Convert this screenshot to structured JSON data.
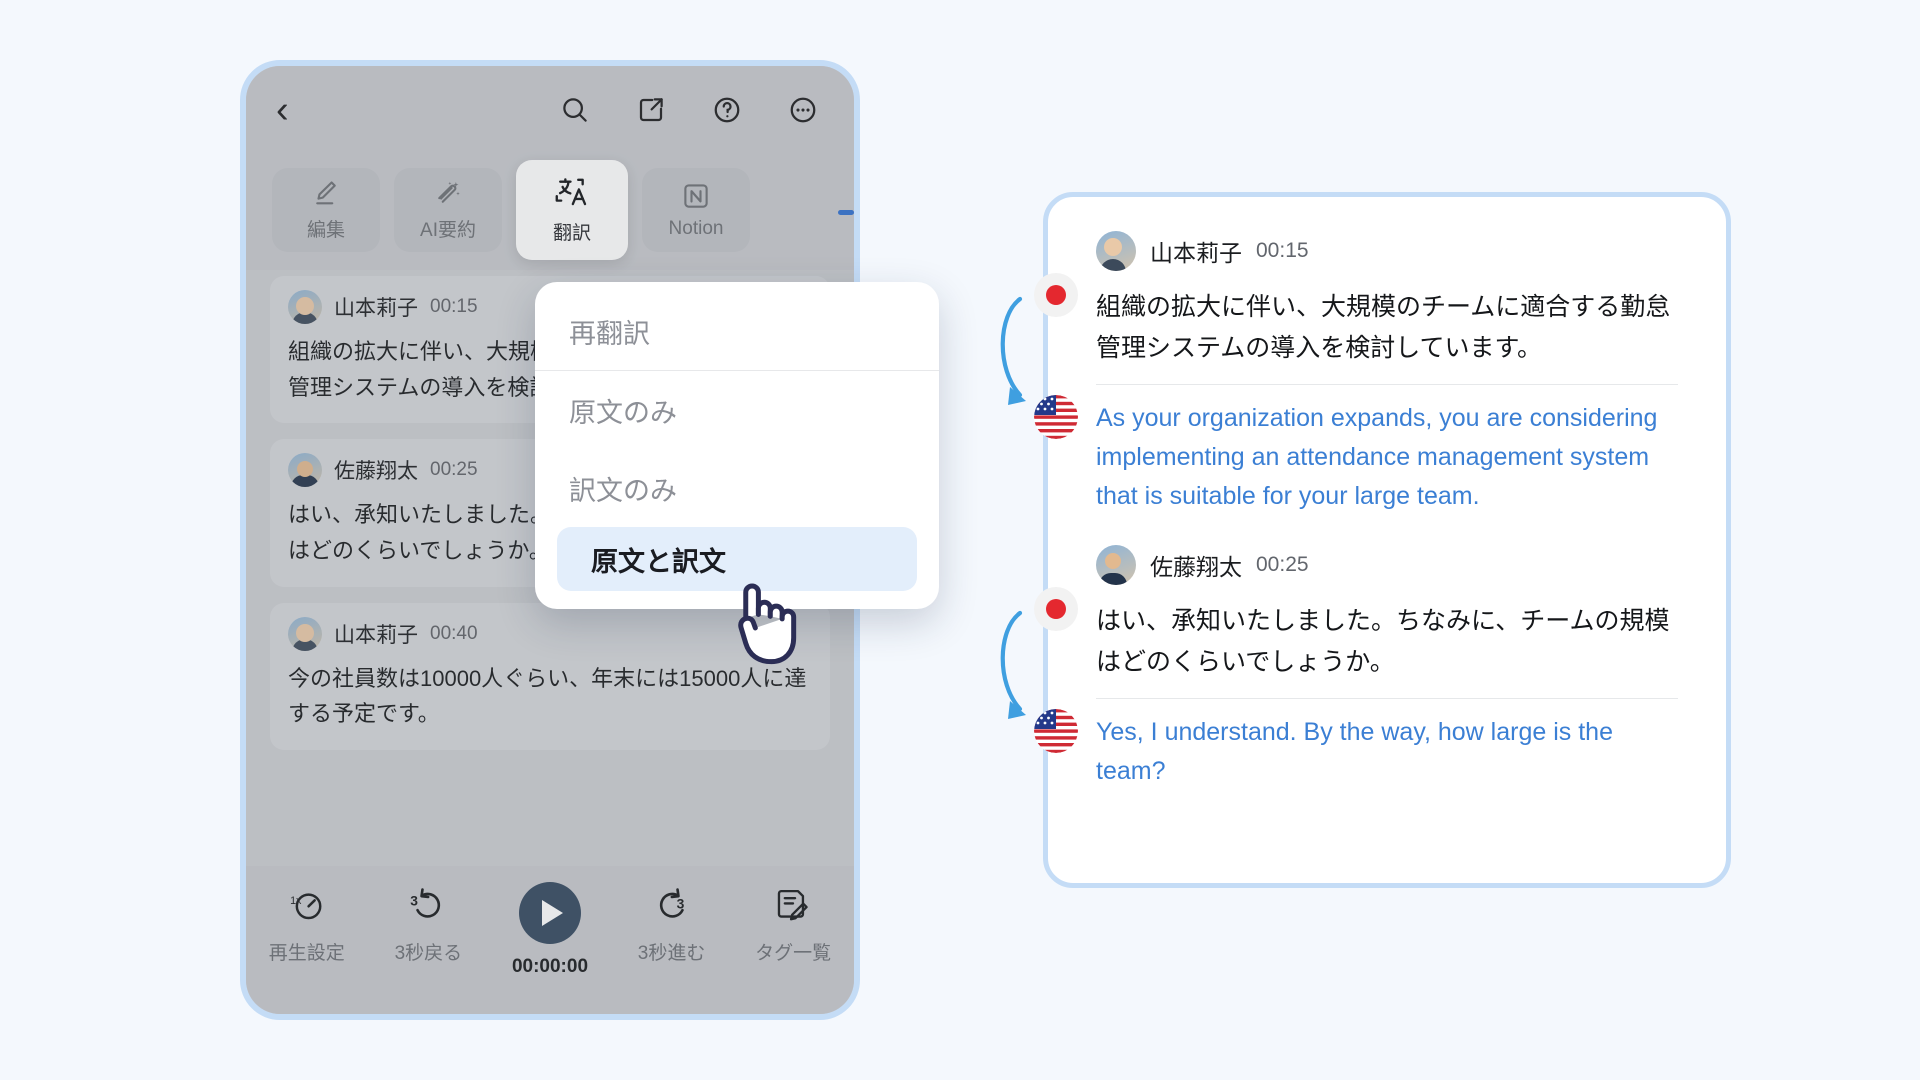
{
  "app": {
    "topbar": {
      "back_icon": "chevron-left-icon",
      "search_icon": "search-icon",
      "export_icon": "share-export-icon",
      "help_icon": "question-circle-icon",
      "more_icon": "more-horizontal-icon"
    },
    "tabs": [
      {
        "label": "編集",
        "icon": "pencil-icon",
        "active": false
      },
      {
        "label": "AI要約",
        "icon": "ai-sparkle-icon",
        "active": false
      },
      {
        "label": "翻訳",
        "icon": "translate-icon",
        "active": true
      },
      {
        "label": "Notion",
        "icon": "notion-icon",
        "active": false
      }
    ],
    "transcript": [
      {
        "speaker": "山本莉子",
        "time": "00:15",
        "avatar": "avatar-female",
        "text": "組織の拡大に伴い、大規模のチームに適合する勤怠管理システムの導入を検討しています。"
      },
      {
        "speaker": "佐藤翔太",
        "time": "00:25",
        "avatar": "avatar-male",
        "text": "はい、承知いたしました。ちなみに、チームの規模はどのくらいでしょうか。"
      },
      {
        "speaker": "山本莉子",
        "time": "00:40",
        "avatar": "avatar-female",
        "text": "今の社員数は10000人ぐらい、年末には15000人に達する予定です。"
      }
    ],
    "player": {
      "items": [
        {
          "label": "再生設定",
          "icon": "playback-speed-1x-icon",
          "emphasis": false
        },
        {
          "label": "3秒戻る",
          "icon": "rewind-3-icon",
          "emphasis": false
        },
        {
          "label": "00:00:00",
          "icon": "play-button-icon",
          "emphasis": true
        },
        {
          "label": "3秒進む",
          "icon": "forward-3-icon",
          "emphasis": false
        },
        {
          "label": "タグ一覧",
          "icon": "tag-list-icon",
          "emphasis": false
        }
      ]
    },
    "dropdown": {
      "items": [
        {
          "label": "再翻訳",
          "selected": false
        },
        {
          "label": "原文のみ",
          "selected": false
        },
        {
          "label": "訳文のみ",
          "selected": false
        },
        {
          "label": "原文と訳文",
          "selected": true
        }
      ]
    },
    "cursor_icon": "hand-pointer-icon"
  },
  "result_card": {
    "blocks": [
      {
        "speaker": "山本莉子",
        "time": "00:15",
        "avatar": "avatar-female",
        "source_flag": "flag-japan",
        "target_flag": "flag-usa",
        "source_text": "組織の拡大に伴い、大規模のチームに適合する勤怠管理システムの導入を検討しています。",
        "translated_text": "As your organization expands, you are considering implementing an attendance management system that is suitable for your large team."
      },
      {
        "speaker": "佐藤翔太",
        "time": "00:25",
        "avatar": "avatar-male",
        "source_flag": "flag-japan",
        "target_flag": "flag-usa",
        "source_text": "はい、承知いたしました。ちなみに、チームの規模はどのくらいでしょうか。",
        "translated_text": "Yes, I understand. By the way, how large is the team?"
      }
    ]
  },
  "colors": {
    "page_background": "#f4f8fd",
    "device_border": "#c4dcf6",
    "device_chrome": "#c7c9ce",
    "message_bubble": "#d4d6da",
    "accent_blue": "#3b7fd4",
    "arrow_blue": "#2fb5e8",
    "play_button": "#33475f",
    "selected_row": "#e3eefb",
    "muted_text": "#8d9097"
  },
  "flow_arrow": {
    "icon": "curved-arrow-right-icon"
  }
}
